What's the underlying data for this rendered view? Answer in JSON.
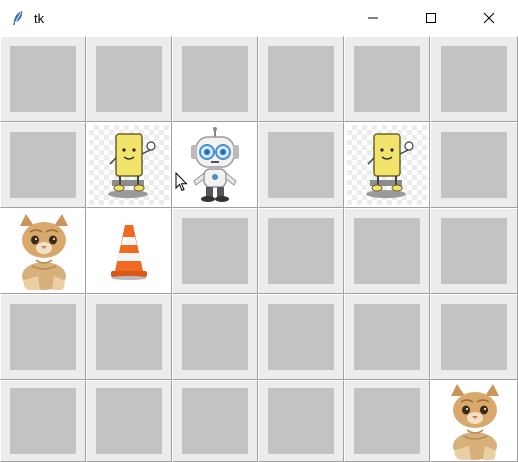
{
  "window": {
    "title": "tk",
    "app_icon": "feather-icon",
    "controls": [
      "minimize-icon",
      "maximize-icon",
      "close-icon"
    ]
  },
  "board": {
    "rows": 5,
    "columns": 6,
    "cells": [
      [
        "empty",
        "empty",
        "empty",
        "empty",
        "empty",
        "empty"
      ],
      [
        "empty",
        "yellow-robot",
        "white-robot",
        "empty",
        "yellow-robot",
        "empty"
      ],
      [
        "kitten",
        "traffic-cone",
        "empty",
        "empty",
        "empty",
        "empty"
      ],
      [
        "empty",
        "empty",
        "empty",
        "empty",
        "empty",
        "empty"
      ],
      [
        "empty",
        "empty",
        "empty",
        "empty",
        "empty",
        "kitten"
      ]
    ]
  },
  "colors": {
    "empty_tile": "#c3c3c3",
    "tile_frame": "#ececec",
    "titlebar": "#ffffff"
  }
}
